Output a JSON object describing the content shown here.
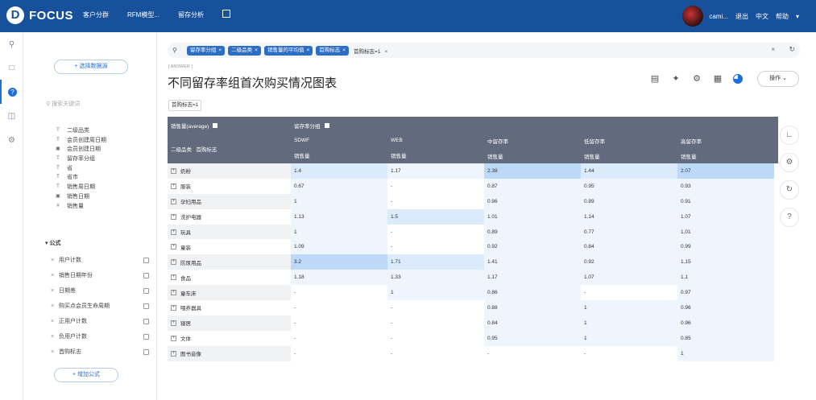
{
  "topbar": {
    "logo_mark": "D",
    "logo_text": "FOCUS",
    "nav": [
      "客户分群",
      "RFM模型...",
      "留存分析"
    ],
    "user_name": "cami...",
    "logout": "退出",
    "language": "中文",
    "help": "帮助"
  },
  "panel": {
    "select_source": "+ 选择数据源",
    "search_placeholder": "搜索关键词",
    "fields": [
      {
        "icon": "T",
        "label": "二级品类"
      },
      {
        "icon": "T",
        "label": "会员创建周日期"
      },
      {
        "icon": "▣",
        "label": "会员创建日期"
      },
      {
        "icon": "T",
        "label": "留存率分组"
      },
      {
        "icon": "T",
        "label": "省"
      },
      {
        "icon": "T",
        "label": "省市"
      },
      {
        "icon": "T",
        "label": "销售周日期"
      },
      {
        "icon": "▣",
        "label": "销售日期"
      },
      {
        "icon": "#",
        "label": "销售量"
      }
    ],
    "formula_title": "公式",
    "formulas": [
      "用户计数",
      "销售日期年份",
      "日期差",
      "购买点会员生命周期",
      "正用户计数",
      "负用户计数",
      "首购标志"
    ],
    "add_formula": "+ 增加公式"
  },
  "query": {
    "chips": [
      "留存率分组",
      "二级品类",
      "销售量的平均值",
      "首购标志"
    ],
    "text": "首购标志=1"
  },
  "answer_tag": "[ ANSWER ]",
  "title": "不同留存率组首次购买情况图表",
  "ops_label": "操作",
  "filter_chip": "首购标志=1",
  "table": {
    "measure_header": "销售量(average)",
    "group_header": "留存率分组",
    "row_header_1": "二级品类",
    "row_header_2": "首购标志",
    "columns": [
      "SDWF",
      "WEB",
      "中留存率",
      "低留存率",
      "高留存率"
    ],
    "sub_label": "销售量",
    "rows": [
      {
        "cat": "奶粉",
        "vals": [
          "1.4",
          "1.17",
          "2.38",
          "1.44",
          "2.07"
        ],
        "lv": [
          2,
          1,
          3,
          2,
          3
        ]
      },
      {
        "cat": "服装",
        "vals": [
          "0.67",
          "-",
          "0.87",
          "0.95",
          "0.93"
        ],
        "lv": [
          1,
          0,
          1,
          1,
          1
        ]
      },
      {
        "cat": "孕妇用品",
        "vals": [
          "1",
          "-",
          "0.96",
          "0.89",
          "0.91"
        ],
        "lv": [
          1,
          0,
          1,
          1,
          1
        ]
      },
      {
        "cat": "洗护电器",
        "vals": [
          "1.13",
          "1.5",
          "1.01",
          "1.14",
          "1.07"
        ],
        "lv": [
          1,
          2,
          1,
          1,
          1
        ]
      },
      {
        "cat": "玩具",
        "vals": [
          "1",
          "-",
          "0.89",
          "0.77",
          "1.01"
        ],
        "lv": [
          1,
          0,
          1,
          1,
          1
        ]
      },
      {
        "cat": "童装",
        "vals": [
          "1.09",
          "-",
          "0.92",
          "0.84",
          "0.99"
        ],
        "lv": [
          1,
          0,
          1,
          1,
          1
        ]
      },
      {
        "cat": "防尿用品",
        "vals": [
          "3.2",
          "1.71",
          "1.41",
          "0.92",
          "1.15"
        ],
        "lv": [
          3,
          2,
          1,
          1,
          1
        ]
      },
      {
        "cat": "食品",
        "vals": [
          "1.18",
          "1.33",
          "1.17",
          "1.07",
          "1.1"
        ],
        "lv": [
          1,
          1,
          1,
          1,
          1
        ]
      },
      {
        "cat": "童车床",
        "vals": [
          "-",
          "1",
          "0.86",
          "-",
          "0.97"
        ],
        "lv": [
          0,
          1,
          1,
          0,
          1
        ]
      },
      {
        "cat": "喂养器具",
        "vals": [
          "-",
          "-",
          "0.88",
          "1",
          "0.96"
        ],
        "lv": [
          0,
          0,
          1,
          1,
          1
        ]
      },
      {
        "cat": "寝居",
        "vals": [
          "-",
          "-",
          "0.84",
          "1",
          "0.96"
        ],
        "lv": [
          0,
          0,
          1,
          1,
          1
        ]
      },
      {
        "cat": "文体",
        "vals": [
          "-",
          "-",
          "0.95",
          "1",
          "0.85"
        ],
        "lv": [
          0,
          0,
          1,
          1,
          1
        ]
      },
      {
        "cat": "图书音像",
        "vals": [
          "-",
          "-",
          "-",
          "-",
          "1"
        ],
        "lv": [
          0,
          0,
          0,
          0,
          1
        ]
      }
    ]
  }
}
